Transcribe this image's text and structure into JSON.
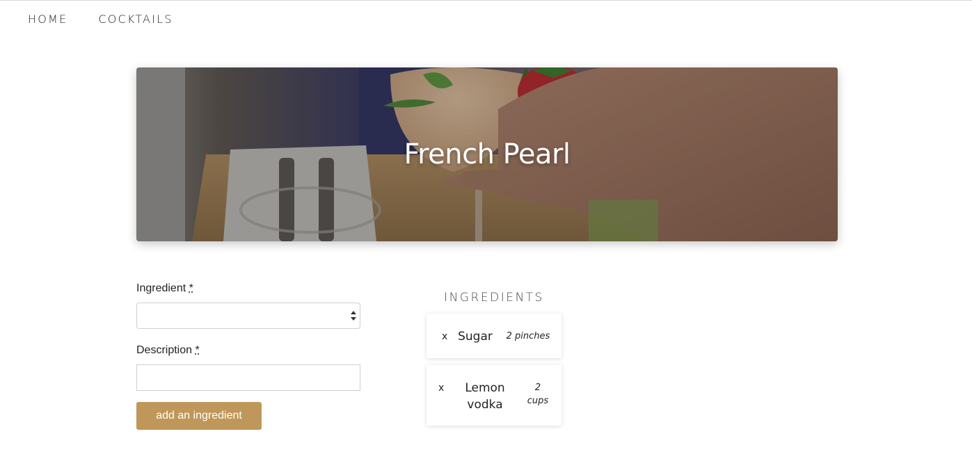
{
  "nav": {
    "items": [
      {
        "label": "HOME"
      },
      {
        "label": "COCKTAILS"
      }
    ]
  },
  "hero": {
    "title": "French Pearl"
  },
  "form": {
    "ingredient_label": "Ingredient",
    "description_label": "Description",
    "required_marker": "*",
    "ingredient_select_value": "",
    "description_value": "",
    "add_button_label": "add an ingredient"
  },
  "ingredients": {
    "title": "INGREDIENTS",
    "remove_glyph": "x",
    "items": [
      {
        "name": "Sugar",
        "quantity": "2 pinches"
      },
      {
        "name": "Lemon vodka",
        "quantity": "2 cups"
      }
    ]
  },
  "colors": {
    "accent": "#c0975a",
    "text": "#222222",
    "border": "#cfcfcf"
  }
}
